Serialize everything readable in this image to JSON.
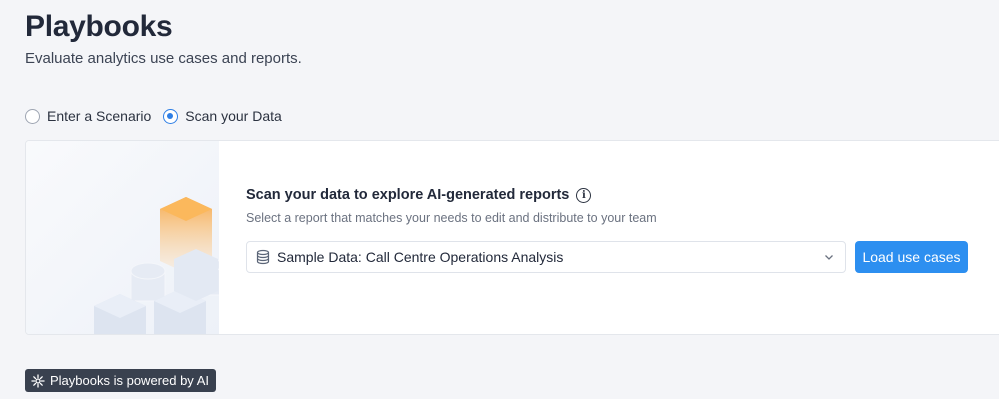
{
  "header": {
    "title": "Playbooks",
    "subtitle": "Evaluate analytics use cases and reports."
  },
  "mode": {
    "options": [
      {
        "label": "Enter a Scenario",
        "selected": false
      },
      {
        "label": "Scan your Data",
        "selected": true
      }
    ]
  },
  "scan_card": {
    "heading": "Scan your data to explore AI-generated reports",
    "info_icon": "info-icon",
    "subheading": "Select a report that matches your needs to edit and distribute to your team",
    "dataset_select": {
      "icon": "database-icon",
      "value": "Sample Data: Call Centre Operations Analysis"
    },
    "load_button_label": "Load use cases"
  },
  "footer": {
    "badge_icon": "ai-sparkle-icon",
    "badge_text": "Playbooks is powered by AI"
  },
  "colors": {
    "accent": "#2d8ff0",
    "radio_selected": "#2f7fe5",
    "badge_bg": "#39414f",
    "cube_highlight": "#f7a94a"
  }
}
